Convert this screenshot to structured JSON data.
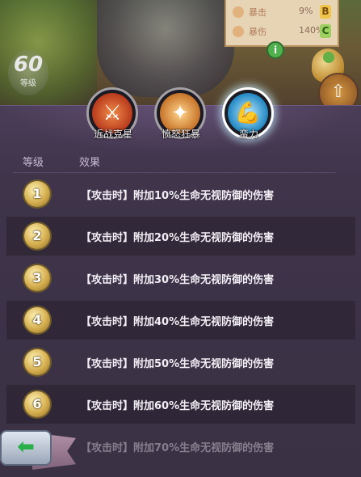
{
  "character": {
    "level": "60",
    "level_label": "等级"
  },
  "stats": [
    {
      "name": "暴击",
      "value": "9%",
      "grade": "B",
      "grade_color": "#e0b238"
    },
    {
      "name": "暴伤",
      "value": "140%",
      "grade": "C",
      "grade_color": "#7bc04e"
    }
  ],
  "skills": [
    {
      "name": "近战克星",
      "icon": "sword-icon",
      "color": "#c7442a"
    },
    {
      "name": "愤怒狂暴",
      "icon": "blade-fury-icon",
      "color": "#c7842a"
    },
    {
      "name": "蛮力",
      "icon": "muscle-arm-icon",
      "color": "#2a8ec7",
      "selected": true
    }
  ],
  "table": {
    "headers": {
      "level": "等级",
      "effect": "效果"
    },
    "rows": [
      {
        "level": "1",
        "effect": "【攻击时】附加10%生命无视防御的伤害"
      },
      {
        "level": "2",
        "effect": "【攻击时】附加20%生命无视防御的伤害"
      },
      {
        "level": "3",
        "effect": "【攻击时】附加30%生命无视防御的伤害"
      },
      {
        "level": "4",
        "effect": "【攻击时】附加40%生命无视防御的伤害"
      },
      {
        "level": "5",
        "effect": "【攻击时】附加50%生命无视防御的伤害"
      },
      {
        "level": "6",
        "effect": "【攻击时】附加60%生命无视防御的伤害"
      },
      {
        "level": "7",
        "effect": "【攻击时】附加70%生命无视防御的伤害"
      }
    ]
  },
  "buttons": {
    "back_icon": "back-arrow-icon",
    "info_icon": "info-icon",
    "upgrade_icon": "upgrade-arrow-icon"
  }
}
